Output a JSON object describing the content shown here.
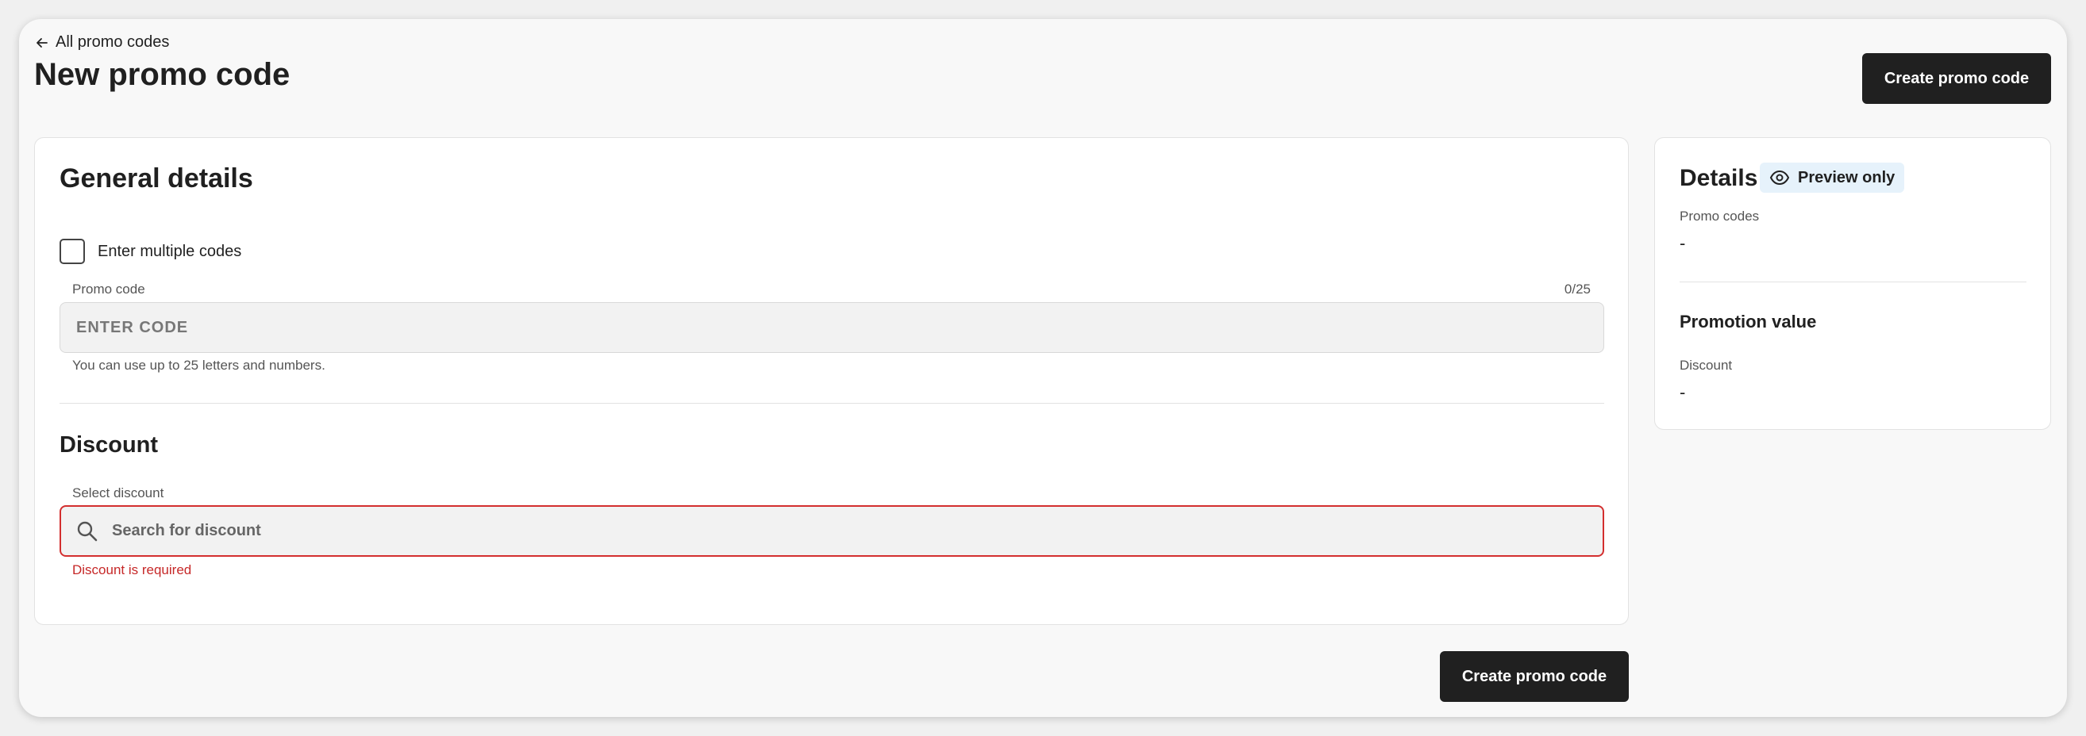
{
  "header": {
    "back_label": "All promo codes",
    "title": "New promo code",
    "create_label": "Create promo code"
  },
  "general": {
    "title": "General details",
    "multiple_codes_label": "Enter multiple codes",
    "promo_code_label": "Promo code",
    "counter": "0/25",
    "promo_code_placeholder": "ENTER CODE",
    "helper": "You can use up to 25 letters and numbers."
  },
  "discount": {
    "title": "Discount",
    "select_label": "Select discount",
    "search_placeholder": "Search for discount",
    "error": "Discount is required"
  },
  "details": {
    "title": "Details",
    "badge": "Preview only",
    "promo_codes_label": "Promo codes",
    "promo_codes_value": "-",
    "promotion_title": "Promotion value",
    "discount_label": "Discount",
    "discount_value": "-"
  },
  "footer": {
    "create_label": "Create promo code"
  },
  "colors": {
    "primary_button": "#202020",
    "error": "#c62828",
    "badge_bg": "#e6f2fb"
  },
  "icons": {
    "back": "arrow-left-icon",
    "search": "search-icon",
    "preview": "eye-icon"
  }
}
